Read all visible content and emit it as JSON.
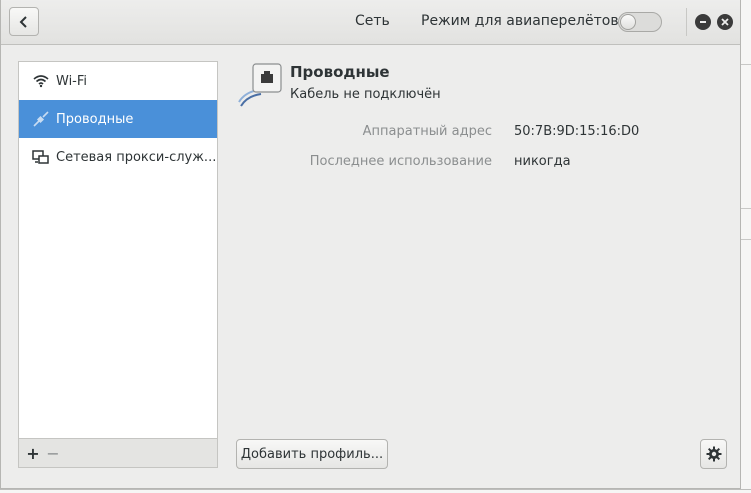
{
  "header": {
    "title": "Сеть",
    "airplane_mode_label": "Режим для авиаперелётов",
    "airplane_mode_on": false
  },
  "sidebar": {
    "items": [
      {
        "label": "Wi-Fi",
        "icon": "wifi-icon",
        "selected": false
      },
      {
        "label": "Проводные",
        "icon": "wired-network-icon",
        "selected": true
      },
      {
        "label": "Сетевая прокси-служ...",
        "icon": "proxy-icon",
        "selected": false
      }
    ],
    "add_symbol": "+",
    "remove_symbol": "−"
  },
  "device": {
    "name": "Проводные",
    "status": "Кабель не подключён",
    "details": [
      {
        "label": "Аппаратный адрес",
        "value": "50:7B:9D:15:16:D0"
      },
      {
        "label": "Последнее использование",
        "value": "никогда"
      }
    ]
  },
  "footer": {
    "add_profile_label": "Добавить профиль..."
  },
  "colors": {
    "selection": "#4a90d9",
    "text": "#2e3436",
    "dim_text": "#8b8e8f"
  }
}
